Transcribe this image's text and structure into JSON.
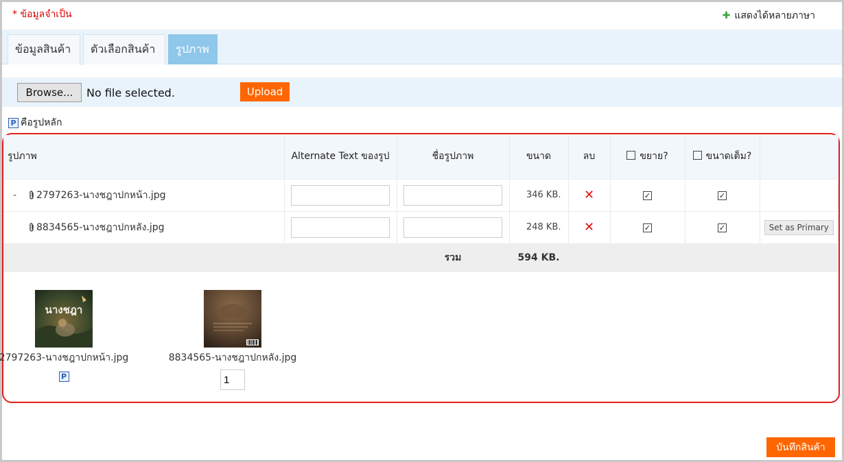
{
  "required_note": "* ข้อมูลจำเป็น",
  "multilang_link": "แสดงได้หลายภาษา",
  "tabs": [
    {
      "label": "ข้อมูลสินค้า",
      "active": false
    },
    {
      "label": "ตัวเลือกสินค้า",
      "active": false
    },
    {
      "label": "รูปภาพ",
      "active": true
    }
  ],
  "upload": {
    "browse_label": "Browse...",
    "file_status": "No file selected.",
    "upload_label": "Upload"
  },
  "legend": {
    "icon_letter": "P",
    "text": "คือรูปหลัก"
  },
  "table": {
    "headers": {
      "image": "รูปภาพ",
      "alt_text": "Alternate Text ของรูป",
      "image_name": "ชื่อรูปภาพ",
      "size": "ขนาด",
      "delete": "ลบ",
      "enlarge": "ขยาย?",
      "full_size": "ขนาดเต็ม?"
    },
    "rows": [
      {
        "prefix": "-",
        "filename": "2797263-นางชฎาปกหน้า.jpg",
        "alt_text": "",
        "image_name": "",
        "size": "346 KB.",
        "enlarge": true,
        "full_size": true,
        "action": ""
      },
      {
        "prefix": "",
        "filename": "8834565-นางชฎาปกหลัง.jpg",
        "alt_text": "",
        "image_name": "",
        "size": "248 KB.",
        "enlarge": true,
        "full_size": true,
        "action": "Set as Primary"
      }
    ],
    "total_label": "รวม",
    "total_size": "594 KB."
  },
  "thumbnails": [
    {
      "caption": "2797263-นางชฎาปกหน้า.jpg",
      "cover_text": "นางชฎา",
      "is_primary": true,
      "primary_letter": "P"
    },
    {
      "caption": "8834565-นางชฎาปกหลัง.jpg",
      "order": "1",
      "is_primary": false
    }
  ],
  "save_label": "บันทึกสินค้า",
  "colors": {
    "accent_orange": "#ff6600",
    "active_tab": "#8ec7ea",
    "highlight_border": "#e21d1d",
    "delete_x": "#e01010"
  }
}
